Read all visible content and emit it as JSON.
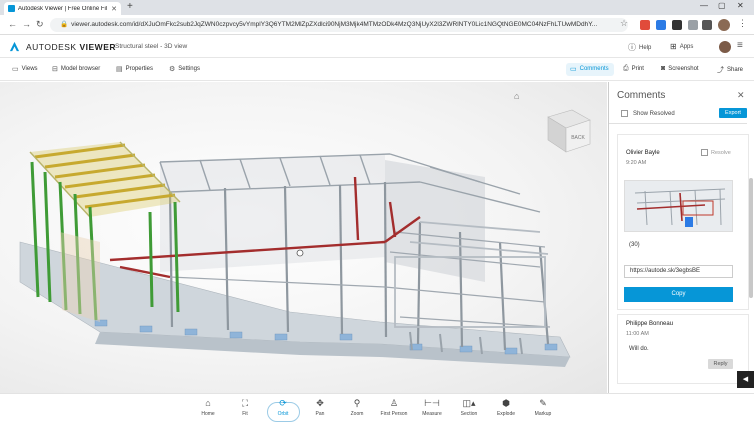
{
  "browser": {
    "tab_title": "Autodesk Viewer | Free Online Fil",
    "url": "viewer.autodesk.com/id/dXJuOmFkc2sub2JqZWN0czpvcy5vYmplY3Q6YTM2MlZpZXdlci90NjM3Mjk4MTMzODk4MzQ3NjUyX2l3ZWRlNTY0Lic1NGQtNGE0MC04NzFhLTUwMDdhY..."
  },
  "app": {
    "brand_light": "AUTODESK",
    "brand_bold": "VIEWER",
    "breadcrumb": "Structural steel - 3D view",
    "help_label": "Help",
    "apps_label": "Apps",
    "brand_color": "#0696d7"
  },
  "toolbar": {
    "views": "Views",
    "model_browser": "Model browser",
    "properties": "Properties",
    "settings": "Settings",
    "comments": "Comments",
    "print": "Print",
    "screenshot": "Screenshot",
    "share": "Share"
  },
  "viewcube": {
    "back": "BACK"
  },
  "comments_panel": {
    "title": "Comments",
    "show_resolved": "Show Resolved",
    "export": "Export",
    "comments": [
      {
        "author": "Olivier Bayle",
        "time": "9:20 AM",
        "resolve": "Resolve",
        "text": "(30)",
        "link": "https://autode.sk/3egbsBE",
        "copy": "Copy"
      },
      {
        "author": "Philippe Bonneau",
        "time": "11:00 AM",
        "text": "Will do.",
        "reply": "Reply"
      }
    ]
  },
  "bottom_toolbar": [
    {
      "label": "Home",
      "icon": "home-icon"
    },
    {
      "label": "Fit",
      "icon": "fit-icon"
    },
    {
      "label": "Orbit",
      "icon": "orbit-icon"
    },
    {
      "label": "Pan",
      "icon": "pan-icon"
    },
    {
      "label": "Zoom",
      "icon": "zoom-icon"
    },
    {
      "label": "First Person",
      "icon": "first-person-icon"
    },
    {
      "label": "Measure",
      "icon": "measure-icon"
    },
    {
      "label": "Section",
      "icon": "section-icon"
    },
    {
      "label": "Explode",
      "icon": "explode-icon"
    },
    {
      "label": "Markup",
      "icon": "markup-icon"
    }
  ]
}
